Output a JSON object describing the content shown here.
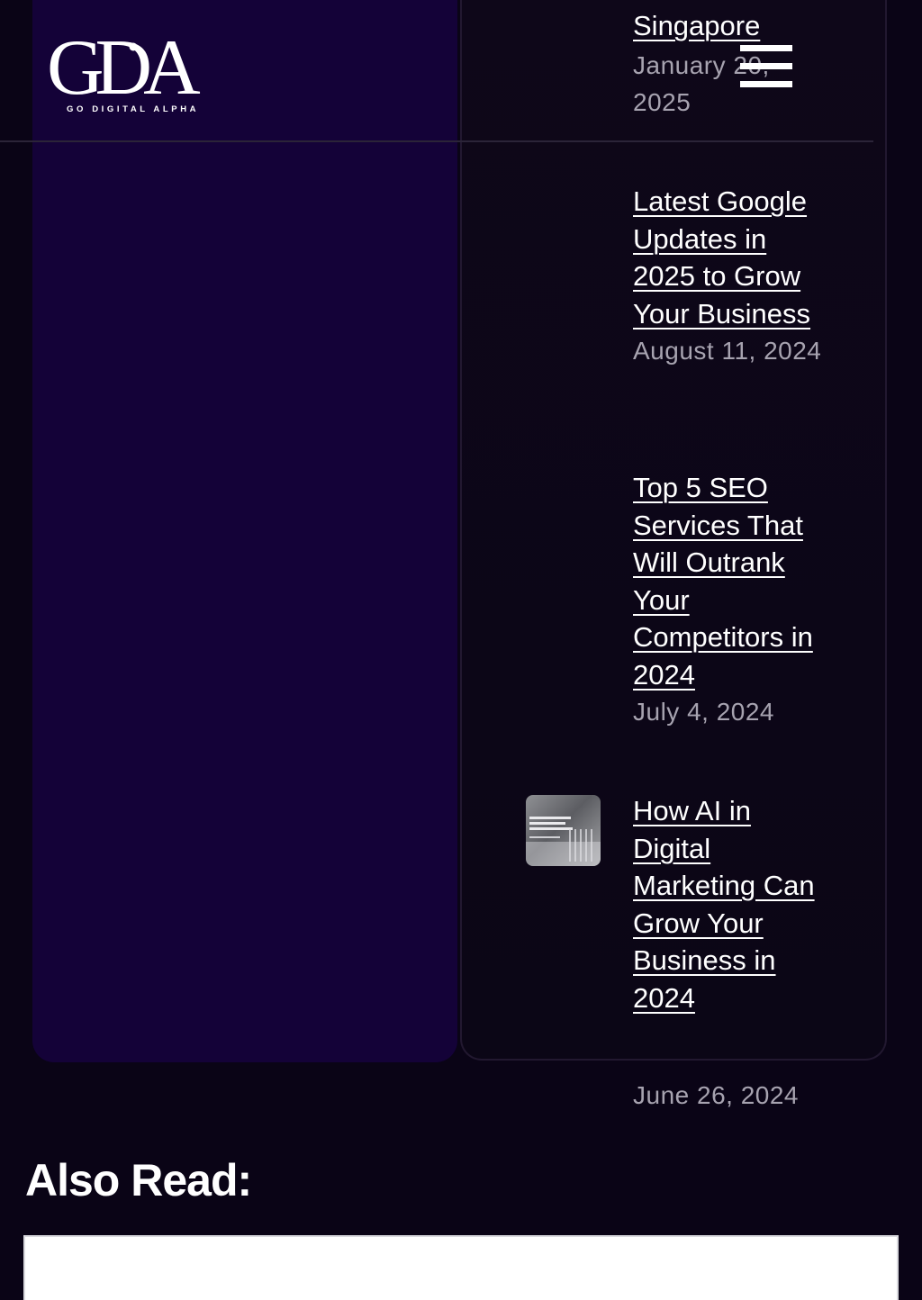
{
  "header": {
    "logo_text": "GDA",
    "logo_tagline": "GO DIGITAL ALPHA",
    "menu_icon": "hamburger-menu-icon"
  },
  "recent_posts": [
    {
      "title": "Singapore",
      "date": "January 20, 2025"
    },
    {
      "title": "Latest Google Updates in 2025 to Grow Your Business",
      "date": "August 11, 2024"
    },
    {
      "title": "Top 5 SEO Services That Will Outrank Your Competitors in 2024",
      "date": "July 4, 2024"
    },
    {
      "title": "How AI in Digital Marketing Can Grow Your Business in 2024",
      "date": "June 26, 2024",
      "thumbnail": "ai-digital-marketing-thumbnail"
    }
  ],
  "also_read": {
    "heading": "Also Read:"
  },
  "colors": {
    "page_background": "#0a0416",
    "left_panel": "#140238",
    "date_text": "#a7a3b0",
    "link_text": "#ffffff"
  }
}
